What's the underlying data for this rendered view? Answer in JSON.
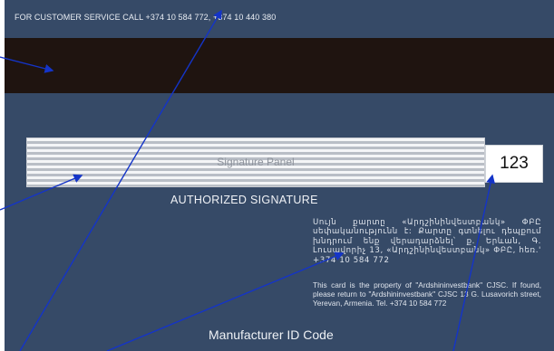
{
  "card": {
    "customer_service": "FOR CUSTOMER SERVICE CALL +374 10 584 772, +374 10 440 380",
    "signature_panel_label": "Signature Panel",
    "cvv": "123",
    "authorized_signature": "AUTHORIZED SIGNATURE",
    "armenian_notice": "Սույն քարտը «Արդշինինվեստբանկ» ՓԲԸ սեփականությունն է: Քարտը գտնելու դեպքում խնդրում ենք վերադարձնել՝ ք. Երևան, Գ. Լուսավորիչ 13, «Արդշինինվեստբանկ» ՓԲԸ, հեռ.' +374 10 584 772",
    "english_notice": "This card is the property of \"Ardshininvestbank\" CJSC. If found, please return to \"Ardshininvestbank\" CJSC 13 G. Lusavorich street, Yerevan, Armenia. Tel. +374 10 584 772",
    "manufacturer_id": "Manufacturer ID Code"
  },
  "colors": {
    "card_body": "#364a67",
    "magnetic_stripe": "#1f1410",
    "arrow": "#1434c8"
  }
}
